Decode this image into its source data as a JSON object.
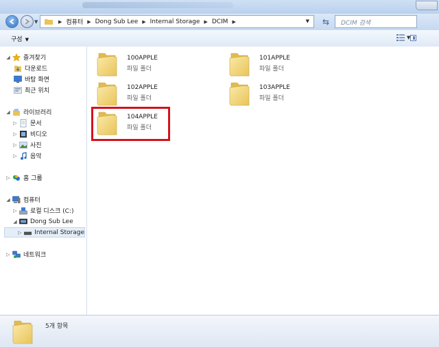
{
  "addressbar": {
    "breadcrumbs": [
      "컴퓨터",
      "Dong Sub Lee",
      "Internal Storage",
      "DCIM"
    ],
    "search_placeholder": "DCIM 검색"
  },
  "toolbar": {
    "organize_label": "구성"
  },
  "nav": {
    "favorites": {
      "label": "즐겨찾기",
      "items": [
        "다운로드",
        "바탕 화면",
        "최근 위치"
      ]
    },
    "libraries": {
      "label": "라이브러리",
      "items": [
        "문서",
        "비디오",
        "사진",
        "음악"
      ]
    },
    "homegroup": "홈 그룹",
    "computer": {
      "label": "컴퓨터",
      "items": [
        "로컬 디스크 (C:)",
        "Dong Sub Lee",
        "Internal Storage"
      ]
    },
    "network": "네트워크"
  },
  "folders": [
    {
      "name": "100APPLE",
      "type": "파일 폴더"
    },
    {
      "name": "101APPLE",
      "type": "파일 폴더"
    },
    {
      "name": "102APPLE",
      "type": "파일 폴더"
    },
    {
      "name": "103APPLE",
      "type": "파일 폴더"
    },
    {
      "name": "104APPLE",
      "type": "파일 폴더"
    }
  ],
  "status": {
    "count": "5개 항목"
  },
  "colors": {
    "highlight": "#d3131a",
    "folder": "#f5d97e"
  }
}
